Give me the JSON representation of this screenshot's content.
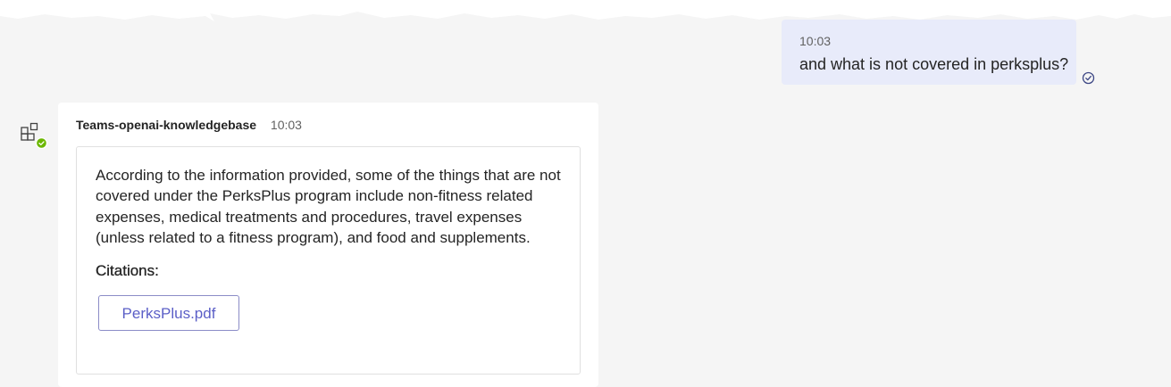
{
  "user_message": {
    "time": "10:03",
    "text": "and what is not covered in perksplus?",
    "status_icon": "read-receipt-check-icon"
  },
  "bot_message": {
    "avatar_icon": "app-grid-icon",
    "presence_icon": "available-presence-icon",
    "sender": "Teams-openai-knowledgebase",
    "time": "10:03",
    "answer": "According to the information provided, some of the things that are not covered under the PerksPlus program include non-fitness related expenses, medical treatments and procedures, travel expenses (unless related to a fitness program), and food and supplements.",
    "citations_title": "Citations:",
    "citations": [
      {
        "label": "PerksPlus.pdf"
      }
    ]
  },
  "colors": {
    "background": "#f5f5f5",
    "user_bubble": "#e8ebfa",
    "card": "#ffffff",
    "accent": "#5b5fc7",
    "presence_green": "#6bb700"
  }
}
